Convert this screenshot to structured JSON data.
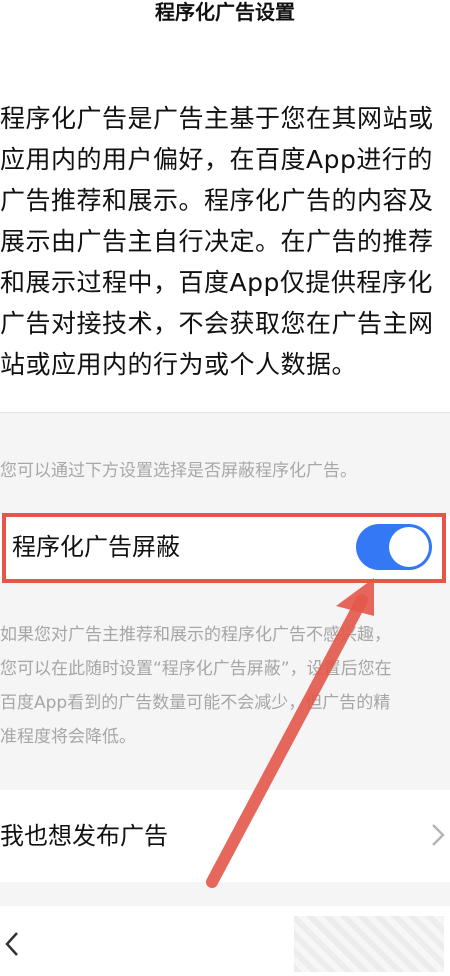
{
  "header": {
    "title": "程序化广告设置"
  },
  "intro": {
    "paragraph": "程序化广告是广告主基于您在其网站或应用内的用户偏好，在百度App进行的广告推荐和展示。程序化广告的内容及展示由广告主自行决定。在广告的推荐和展示过程中，百度App仅提供程序化广告对接技术，不会获取您在广告主网站或应用内的行为或个人数据。"
  },
  "hint": "您可以通过下方设置选择是否屏蔽程序化广告。",
  "toggle_row": {
    "label": "程序化广告屏蔽",
    "enabled": true
  },
  "explanation": {
    "lines": [
      "如果您对广告主推荐和展示的程序化广告不感兴趣，",
      "您可以在此随时设置“程序化广告屏蔽”，设置后您在",
      "百度App看到的广告数量可能不会减少，但广告的精",
      "准程度将会降低。"
    ]
  },
  "publish_row": {
    "label": "我也想发布广告"
  },
  "icons": {
    "toggle_row": "switch-icon",
    "publish_row": "chevron-right-icon",
    "bottom_bar": "back-arrow-icon"
  },
  "colors": {
    "switch_on": "#3478f6",
    "annotation": "#e4574a"
  }
}
